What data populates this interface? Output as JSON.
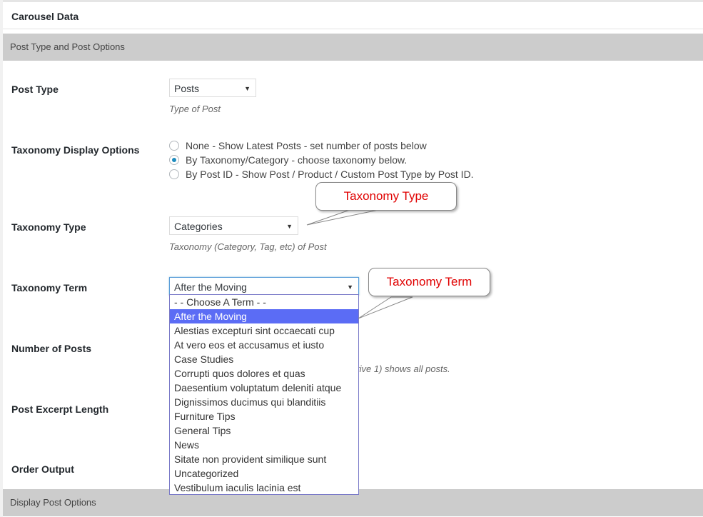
{
  "panel": {
    "title": "Carousel Data"
  },
  "sections": {
    "post_options": "Post Type and Post Options",
    "display_options": "Display Post Options"
  },
  "fields": {
    "post_type": {
      "label": "Post Type",
      "value": "Posts",
      "description": "Type of Post"
    },
    "taxonomy_display": {
      "label": "Taxonomy Display Options",
      "options": [
        {
          "label": "None - Show Latest Posts - set number of posts below",
          "checked": false
        },
        {
          "label": "By Taxonomy/Category - choose taxonomy below.",
          "checked": true
        },
        {
          "label": "By Post ID - Show Post / Product / Custom Post Type by Post ID.",
          "checked": false
        }
      ]
    },
    "taxonomy_type": {
      "label": "Taxonomy Type",
      "value": "Categories",
      "description": "Taxonomy (Category, Tag, etc) of Post"
    },
    "taxonomy_term": {
      "label": "Taxonomy Term",
      "value": "After the Moving",
      "options": [
        "- - Choose A Term - -",
        "After the Moving",
        "Alestias excepturi sint occaecati cup",
        "At vero eos et accusamus et iusto",
        "Case Studies",
        "Corrupti quos dolores et quas",
        "Daesentium voluptatum deleniti atque",
        "Dignissimos ducimus qui blanditiis",
        "Furniture Tips",
        "General Tips",
        "News",
        "Sitate non provident similique sunt",
        "Uncategorized",
        "Vestibulum iaculis lacinia est"
      ],
      "selected_index": 1
    },
    "number_of_posts": {
      "label": "Number of Posts",
      "description_visible": "tive 1) shows all posts."
    },
    "post_excerpt_length": {
      "label": "Post Excerpt Length"
    },
    "order_output": {
      "label": "Order Output"
    }
  },
  "callouts": {
    "taxonomy_type": "Taxonomy Type",
    "taxonomy_term": "Taxonomy Term"
  },
  "icons": {
    "select_arrow": "▼"
  },
  "colors": {
    "callout_text": "#e00000",
    "selected_option_bg": "#5b6cf5",
    "radio_checked": "#1e8cbe",
    "section_bar_bg": "#cccccc"
  }
}
